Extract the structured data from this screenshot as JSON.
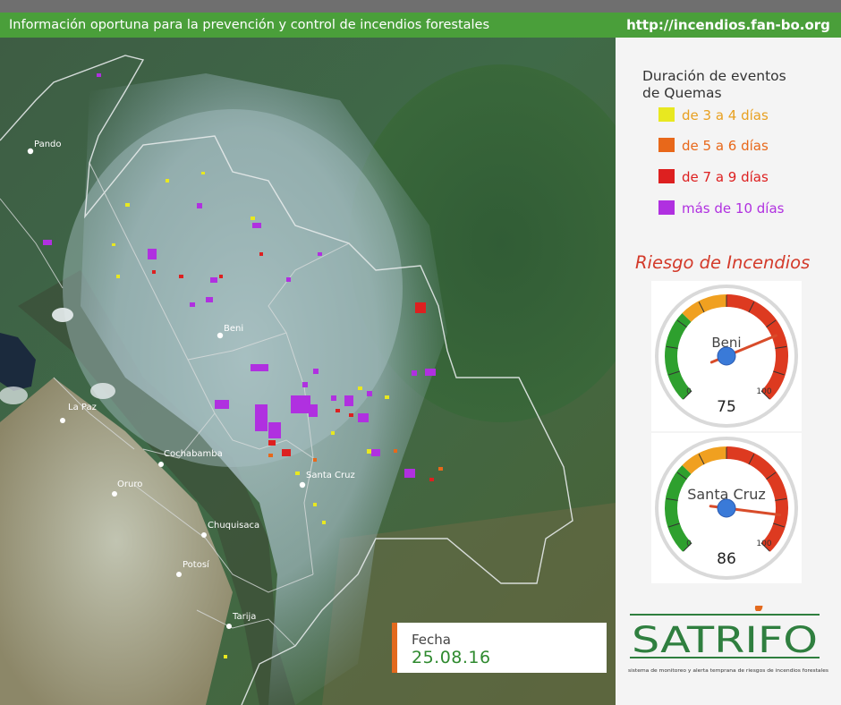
{
  "header": {
    "title": "Información oportuna para la prevención y control de incendios forestales",
    "url": "http://incendios.fan-bo.org"
  },
  "legend": {
    "title_line1": "Duración de eventos",
    "title_line2": "de Quemas",
    "items": [
      {
        "label": "de 3 a 4 días",
        "color": "#e8e820",
        "text_color": "#e8a020"
      },
      {
        "label": "de 5 a 6 días",
        "color": "#e8681a",
        "text_color": "#e8681a"
      },
      {
        "label": "de 7 a 9 días",
        "color": "#dd2020",
        "text_color": "#dd2020"
      },
      {
        "label": "más de 10 días",
        "color": "#b030e0",
        "text_color": "#b030e0"
      }
    ]
  },
  "risk": {
    "title": "Riesgo de Incendios",
    "gauges": [
      {
        "name": "Beni",
        "value": 75,
        "min_label": "0",
        "max_label": "100",
        "min": 0,
        "max": 100
      },
      {
        "name": "Santa Cruz",
        "value": 86,
        "min_label": "0",
        "max_label": "100",
        "min": 0,
        "max": 100
      }
    ]
  },
  "map": {
    "cities": [
      "Pando",
      "Beni",
      "La Paz",
      "Cochabamba",
      "Oruro",
      "Santa Cruz",
      "Chuquisaca",
      "Potosí",
      "Tarija"
    ]
  },
  "fecha": {
    "label": "Fecha",
    "date": "25.08.16"
  },
  "logo": {
    "name": "SATRIFO",
    "tagline": "sistema de monitoreo y alerta temprana de riesgos de incendios forestales",
    "color": "#2f7f3f",
    "flame_color": "#e36a1e"
  }
}
